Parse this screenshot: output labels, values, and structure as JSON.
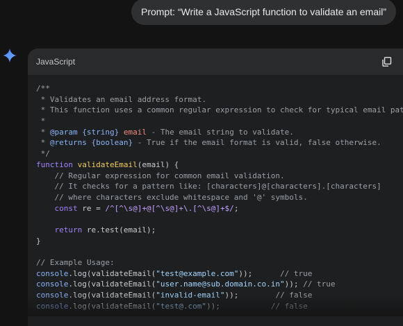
{
  "prompt": {
    "text": "Prompt: “Write a JavaScript function to validate an email”"
  },
  "code_block": {
    "language": "JavaScript",
    "copy_icon": "copy-icon",
    "lines": [
      {
        "indent": "",
        "segs": [
          {
            "t": "c",
            "v": "/**"
          }
        ]
      },
      {
        "indent": "",
        "segs": [
          {
            "t": "c",
            "v": " * Validates an email address format."
          }
        ]
      },
      {
        "indent": "",
        "segs": [
          {
            "t": "c",
            "v": " * This function uses a common regular expression to check for typical email patte"
          }
        ]
      },
      {
        "indent": "",
        "segs": [
          {
            "t": "c",
            "v": " *"
          }
        ]
      },
      {
        "indent": "",
        "segs": [
          {
            "t": "c",
            "v": " * "
          },
          {
            "t": "t",
            "v": "@param"
          },
          {
            "t": "c",
            "v": " "
          },
          {
            "t": "t",
            "v": "{string}"
          },
          {
            "t": "c",
            "v": " "
          },
          {
            "t": "p",
            "v": "email"
          },
          {
            "t": "c",
            "v": " - The email string to validate."
          }
        ]
      },
      {
        "indent": "",
        "segs": [
          {
            "t": "c",
            "v": " * "
          },
          {
            "t": "t",
            "v": "@returns"
          },
          {
            "t": "c",
            "v": " "
          },
          {
            "t": "t",
            "v": "{boolean}"
          },
          {
            "t": "c",
            "v": " - True if the email format is valid, false otherwise."
          }
        ]
      },
      {
        "indent": "",
        "segs": [
          {
            "t": "c",
            "v": " */"
          }
        ]
      },
      {
        "indent": "",
        "segs": [
          {
            "t": "k",
            "v": "function"
          },
          {
            "t": "n",
            "v": " "
          },
          {
            "t": "f",
            "v": "validateEmail"
          },
          {
            "t": "n",
            "v": "(email) {"
          }
        ]
      },
      {
        "indent": "",
        "segs": [
          {
            "t": "c",
            "v": "    // Regular expression for common email validation."
          }
        ]
      },
      {
        "indent": "",
        "segs": [
          {
            "t": "c",
            "v": "    // It checks for a pattern like: [characters]@[characters].[characters]"
          }
        ]
      },
      {
        "indent": "",
        "segs": [
          {
            "t": "c",
            "v": "    // where characters exclude whitespace and '@' symbols."
          }
        ]
      },
      {
        "indent": "",
        "segs": [
          {
            "t": "n",
            "v": "    "
          },
          {
            "t": "k",
            "v": "const"
          },
          {
            "t": "n",
            "v": " re = "
          },
          {
            "t": "r",
            "v": "/^[^\\s@]+@[^\\s@]+\\.[^\\s@]+$/"
          },
          {
            "t": "n",
            "v": ";"
          }
        ]
      },
      {
        "indent": "",
        "segs": [
          {
            "t": "n",
            "v": ""
          }
        ]
      },
      {
        "indent": "",
        "segs": [
          {
            "t": "n",
            "v": "    "
          },
          {
            "t": "k",
            "v": "return"
          },
          {
            "t": "n",
            "v": " re.test(email);"
          }
        ]
      },
      {
        "indent": "",
        "segs": [
          {
            "t": "n",
            "v": "}"
          }
        ]
      },
      {
        "indent": "",
        "segs": [
          {
            "t": "n",
            "v": ""
          }
        ]
      },
      {
        "indent": "",
        "segs": [
          {
            "t": "c",
            "v": "// Example Usage:"
          }
        ]
      },
      {
        "indent": "",
        "segs": [
          {
            "t": "t",
            "v": "console"
          },
          {
            "t": "n",
            "v": ".log(validateEmail("
          },
          {
            "t": "s",
            "v": "\"test@example.com\""
          },
          {
            "t": "n",
            "v": "));      "
          },
          {
            "t": "c",
            "v": "// true"
          }
        ]
      },
      {
        "indent": "",
        "segs": [
          {
            "t": "t",
            "v": "console"
          },
          {
            "t": "n",
            "v": ".log(validateEmail("
          },
          {
            "t": "s",
            "v": "\"user.name@sub.domain.co.in\""
          },
          {
            "t": "n",
            "v": ")); "
          },
          {
            "t": "c",
            "v": "// true"
          }
        ]
      },
      {
        "indent": "",
        "segs": [
          {
            "t": "t",
            "v": "console"
          },
          {
            "t": "n",
            "v": ".log(validateEmail("
          },
          {
            "t": "s",
            "v": "\"invalid-email\""
          },
          {
            "t": "n",
            "v": "));        "
          },
          {
            "t": "c",
            "v": "// false"
          }
        ]
      },
      {
        "indent": "",
        "segs": [
          {
            "t": "t",
            "v": "console"
          },
          {
            "t": "n",
            "v": ".log(validateEmail("
          },
          {
            "t": "s",
            "v": "\"test@.com\""
          },
          {
            "t": "n",
            "v": "));           "
          },
          {
            "t": "c",
            "v": "// false"
          }
        ]
      }
    ]
  },
  "colors": {
    "background": "#131314",
    "card": "#1e1f20",
    "accent_spark": "#4c8df6"
  }
}
